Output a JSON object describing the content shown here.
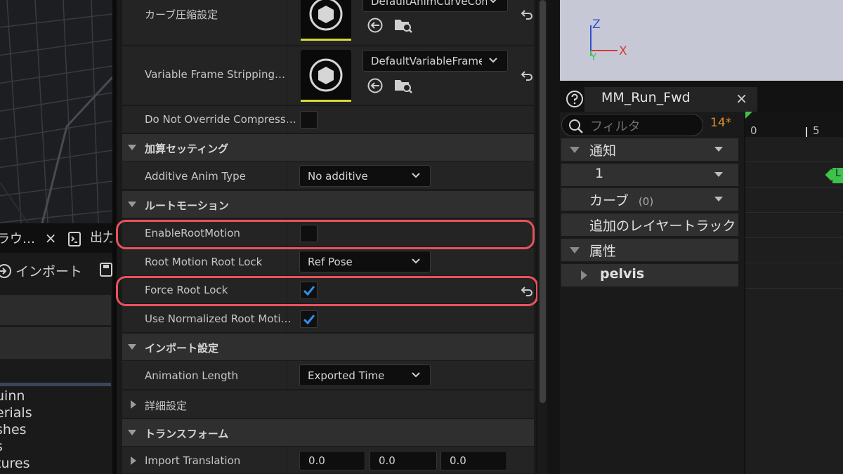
{
  "content_browser": {
    "tabs": [
      {
        "label": "ラウ…",
        "icon": "folder-icon"
      },
      {
        "label": "出力",
        "icon": "output-log-icon"
      }
    ],
    "close_glyph": "×",
    "import_label": "インポート",
    "tree_items": [
      "uinn",
      "erials",
      "shes",
      "s",
      "tures"
    ]
  },
  "details": {
    "rows": {
      "curve_compression": {
        "label": "カーブ圧縮設定",
        "value": "DefaultAnimCurveCompressionSettings"
      },
      "variable_frame": {
        "label": "Variable Frame Stripping…",
        "value": "DefaultVariableFrameStrippingSettings"
      },
      "do_not_override": {
        "label": "Do Not Override Compress…",
        "checked": false
      },
      "additive_type": {
        "label": "Additive Anim Type",
        "value": "No additive"
      },
      "enable_root_motion": {
        "label": "EnableRootMotion",
        "checked": false
      },
      "root_lock": {
        "label": "Root Motion Root Lock",
        "value": "Ref Pose"
      },
      "force_root_lock": {
        "label": "Force Root Lock",
        "checked": true
      },
      "use_normalized": {
        "label": "Use Normalized Root Moti…",
        "checked": true
      },
      "animation_length": {
        "label": "Animation Length",
        "value": "Exported Time"
      },
      "import_translation": {
        "label": "Import Translation",
        "x": "0.0",
        "y": "0.0",
        "z": "0.0"
      }
    },
    "categories": {
      "additive": "加算セッティング",
      "root_motion": "ルートモーション",
      "import_settings": "インポート設定",
      "advanced": "詳細設定",
      "transform": "トランスフォーム"
    }
  },
  "viewport": {
    "axis_z": "Z",
    "axis_x": "X",
    "axis_y": "Y"
  },
  "anim_editor": {
    "tab_title": "MM_Run_Fwd",
    "close_glyph": "×",
    "filter_placeholder": "フィルタ",
    "count": "14*",
    "tracks": [
      {
        "label": "通知",
        "expanded": true
      },
      {
        "label": "1",
        "sub": true
      },
      {
        "label": "カーブ",
        "count": "(0)"
      },
      {
        "label": "追加のレイヤートラック"
      },
      {
        "label": "属性",
        "expanded": true
      },
      {
        "label": "pelvis",
        "collapsed": true
      }
    ],
    "ruler_ticks": [
      "0",
      "5"
    ],
    "notify_marker_label": "L"
  },
  "colors": {
    "highlight": "#e8525a",
    "check": "#2f8fe8",
    "accent_yellow": "#d9d93a",
    "count_orange": "#e3902d"
  }
}
